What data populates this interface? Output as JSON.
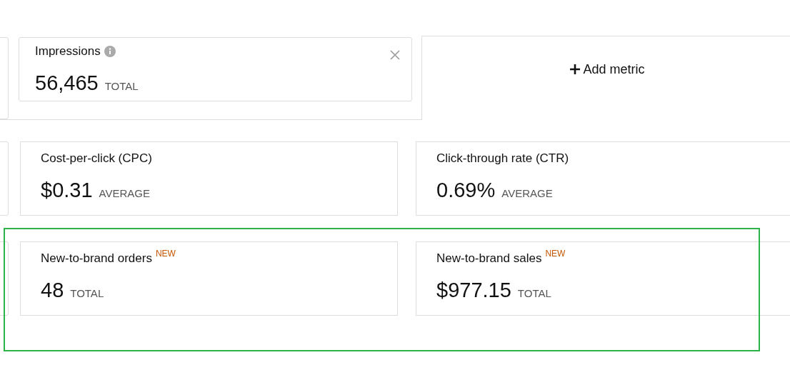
{
  "top_row": {
    "cards": [
      {
        "label": "Impressions",
        "info": true,
        "removable": true,
        "value": "56,465",
        "unit": "TOTAL"
      }
    ],
    "add_button": "Add metric"
  },
  "rows": [
    {
      "highlighted": false,
      "cards": [
        {
          "label": "Cost-per-click (CPC)",
          "value": "$0.31",
          "unit": "AVERAGE"
        },
        {
          "label": "Click-through rate (CTR)",
          "value": "0.69%",
          "unit": "AVERAGE"
        }
      ]
    },
    {
      "highlighted": true,
      "cards": [
        {
          "label": "New-to-brand orders",
          "badge": "NEW",
          "value": "48",
          "unit": "TOTAL"
        },
        {
          "label": "New-to-brand sales",
          "badge": "NEW",
          "value": "$977.15",
          "unit": "TOTAL"
        }
      ]
    }
  ]
}
